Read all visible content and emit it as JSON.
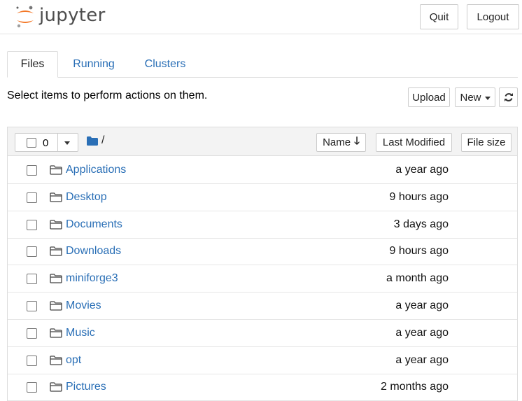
{
  "header": {
    "logo_text": "jupyter",
    "quit_label": "Quit",
    "logout_label": "Logout"
  },
  "tabs": [
    {
      "label": "Files",
      "active": true
    },
    {
      "label": "Running",
      "active": false
    },
    {
      "label": "Clusters",
      "active": false
    }
  ],
  "toolbar": {
    "hint": "Select items to perform actions on them.",
    "upload_label": "Upload",
    "new_label": "New",
    "refresh_icon": "refresh-icon"
  },
  "list_header": {
    "selected_count": "0",
    "breadcrumb": "/",
    "sort_name_label": "Name",
    "sort_name_arrow": "🡓",
    "sort_modified_label": "Last Modified",
    "sort_size_label": "File size"
  },
  "files": [
    {
      "name": "Applications",
      "modified": "a year ago",
      "icon": "folder-icon"
    },
    {
      "name": "Desktop",
      "modified": "9 hours ago",
      "icon": "folder-icon"
    },
    {
      "name": "Documents",
      "modified": "3 days ago",
      "icon": "folder-icon"
    },
    {
      "name": "Downloads",
      "modified": "9 hours ago",
      "icon": "folder-icon"
    },
    {
      "name": "miniforge3",
      "modified": "a month ago",
      "icon": "folder-icon"
    },
    {
      "name": "Movies",
      "modified": "a year ago",
      "icon": "folder-icon"
    },
    {
      "name": "Music",
      "modified": "a year ago",
      "icon": "folder-icon"
    },
    {
      "name": "opt",
      "modified": "a year ago",
      "icon": "folder-icon"
    },
    {
      "name": "Pictures",
      "modified": "2 months ago",
      "icon": "folder-icon"
    }
  ],
  "colors": {
    "link": "#2a6fb6",
    "logo_orange": "#f37726",
    "logo_gray": "#616262"
  }
}
